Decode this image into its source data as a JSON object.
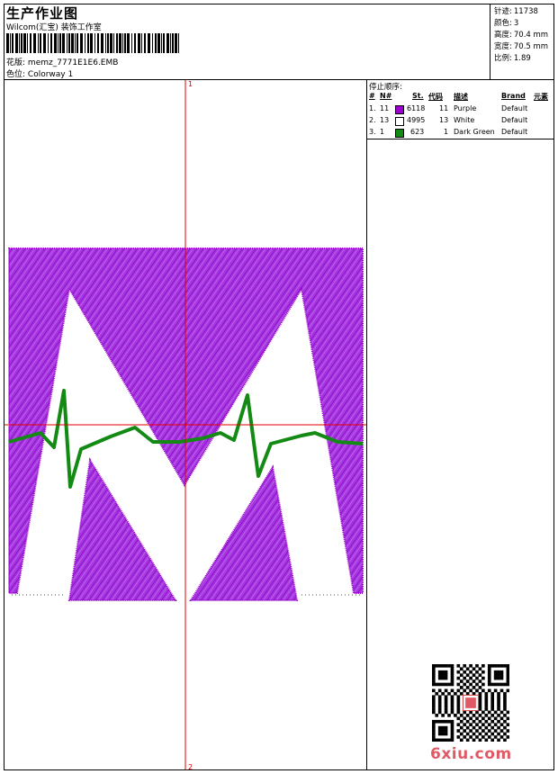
{
  "header": {
    "title": "生产作业图",
    "company": "Wilcom(汇宝) 装饰工作室",
    "file_label": "花版:",
    "file_name": "memz_7771E1E6.EMB",
    "colorway_label": "色位:",
    "colorway": "Colorway 1"
  },
  "stats": [
    {
      "label": "针迹:",
      "value": "11738"
    },
    {
      "label": "颜色:",
      "value": "3"
    },
    {
      "label": "高度:",
      "value": "70.4 mm"
    },
    {
      "label": "宽度:",
      "value": "70.5 mm"
    },
    {
      "label": "比例:",
      "value": "1.89"
    }
  ],
  "stops": {
    "title": "停止顺序:",
    "headers": [
      "#",
      "N#",
      "St.",
      "代码",
      "描述",
      "Brand",
      "元素"
    ],
    "rows": [
      {
        "idx": "1.",
        "n": "11",
        "color": "#9b00d0",
        "st": "6118",
        "code": "11",
        "desc": "Purple",
        "brand": "Default"
      },
      {
        "idx": "2.",
        "n": "13",
        "color": "#ffffff",
        "st": "4995",
        "code": "13",
        "desc": "White",
        "brand": "Default"
      },
      {
        "idx": "3.",
        "n": "1",
        "color": "#138a13",
        "st": "623",
        "code": "1",
        "desc": "Dark Green",
        "brand": "Default"
      }
    ]
  },
  "axis": {
    "top_label": "1",
    "bottom_label": "2"
  },
  "watermark": "6xiu.com",
  "colors": {
    "purple": "#9b00d0",
    "green": "#138a13",
    "axis": "#e00000"
  }
}
